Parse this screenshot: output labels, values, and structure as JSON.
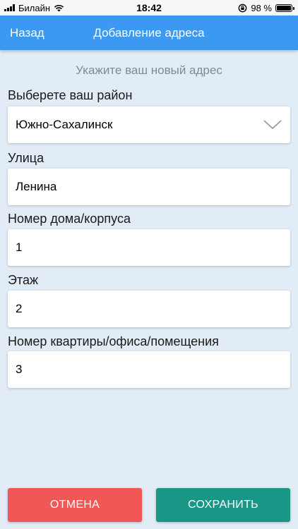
{
  "status_bar": {
    "carrier": "Билайн",
    "time": "18:42",
    "battery_text": "98 %",
    "battery_level": 0.98,
    "icons": [
      "signal-icon",
      "wifi-icon",
      "orientation-lock-icon",
      "battery-icon"
    ]
  },
  "nav": {
    "back_label": "Назад",
    "title": "Добавление адреса"
  },
  "form": {
    "subtitle": "Укажите ваш новый адрес",
    "district": {
      "label": "Выберете ваш район",
      "value": "Южно-Сахалинск"
    },
    "street": {
      "label": "Улица",
      "value": "Ленина"
    },
    "house": {
      "label": "Номер дома/корпуса",
      "value": "1"
    },
    "floor": {
      "label": "Этаж",
      "value": "2"
    },
    "apartment": {
      "label": "Номер квартиры/офиса/помещения",
      "value": "3"
    }
  },
  "actions": {
    "cancel_label": "ОТМЕНА",
    "save_label": "СОХРАНИТЬ"
  },
  "colors": {
    "nav_bg": "#3b99f2",
    "page_bg": "#e2ecf6",
    "cancel_bg": "#f25757",
    "save_bg": "#1a9686"
  }
}
